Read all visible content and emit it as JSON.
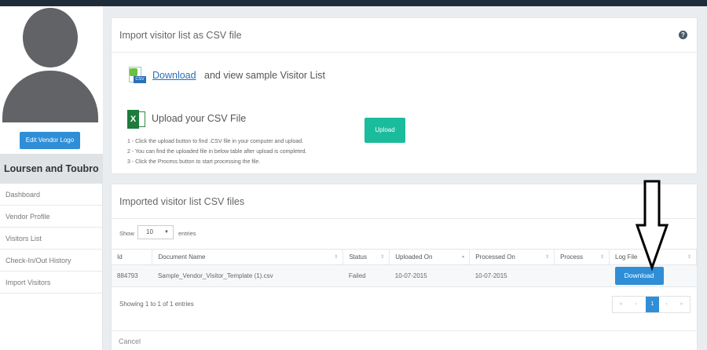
{
  "sidebar": {
    "edit_logo": "Edit Vendor Logo",
    "vendor_name": "Loursen and Toubro",
    "items": [
      {
        "label": "Dashboard"
      },
      {
        "label": "Vendor Profile"
      },
      {
        "label": "Visitors List"
      },
      {
        "label": "Check-In/Out History"
      },
      {
        "label": "Import Visitors"
      }
    ]
  },
  "import_panel": {
    "title": "Import visitor list as CSV file",
    "help_icon": "?",
    "download_link": "Download",
    "download_text": "and view sample Visitor List",
    "csv_tag": "CSV",
    "excel_letter": "X",
    "upload_title": "Upload your CSV File",
    "upload_button": "Upload",
    "instructions": [
      "1 - Click the upload button to find .CSV file in your computer and upload.",
      "2 - You can find the uploaded file in below table after upload is completed.",
      "3 - Click the Process button to start processing the file."
    ]
  },
  "files_panel": {
    "title": "Imported visitor list CSV files",
    "show_label": "Show",
    "entries_value": "10",
    "entries_label": "entries",
    "columns": [
      "Id",
      "Document Name",
      "Status",
      "Uploaded On",
      "Processed On",
      "Process",
      "Log File"
    ],
    "rows": [
      {
        "id": "884793",
        "document": "Sample_Vendor_Visitor_Template (1).csv",
        "status": "Failed",
        "uploaded": "10-07-2015",
        "processed": "10-07-2015",
        "process": "",
        "log_button": "Download"
      }
    ],
    "showing": "Showing 1 to 1 of 1 entries",
    "pager": {
      "first": "«",
      "prev": "‹",
      "current": "1",
      "next": "›",
      "last": "»"
    },
    "cancel": "Cancel"
  },
  "colors": {
    "primary": "#2f8ed6",
    "upload": "#1abc9c",
    "topbar": "#1f2d3b",
    "avatar": "#616366"
  }
}
